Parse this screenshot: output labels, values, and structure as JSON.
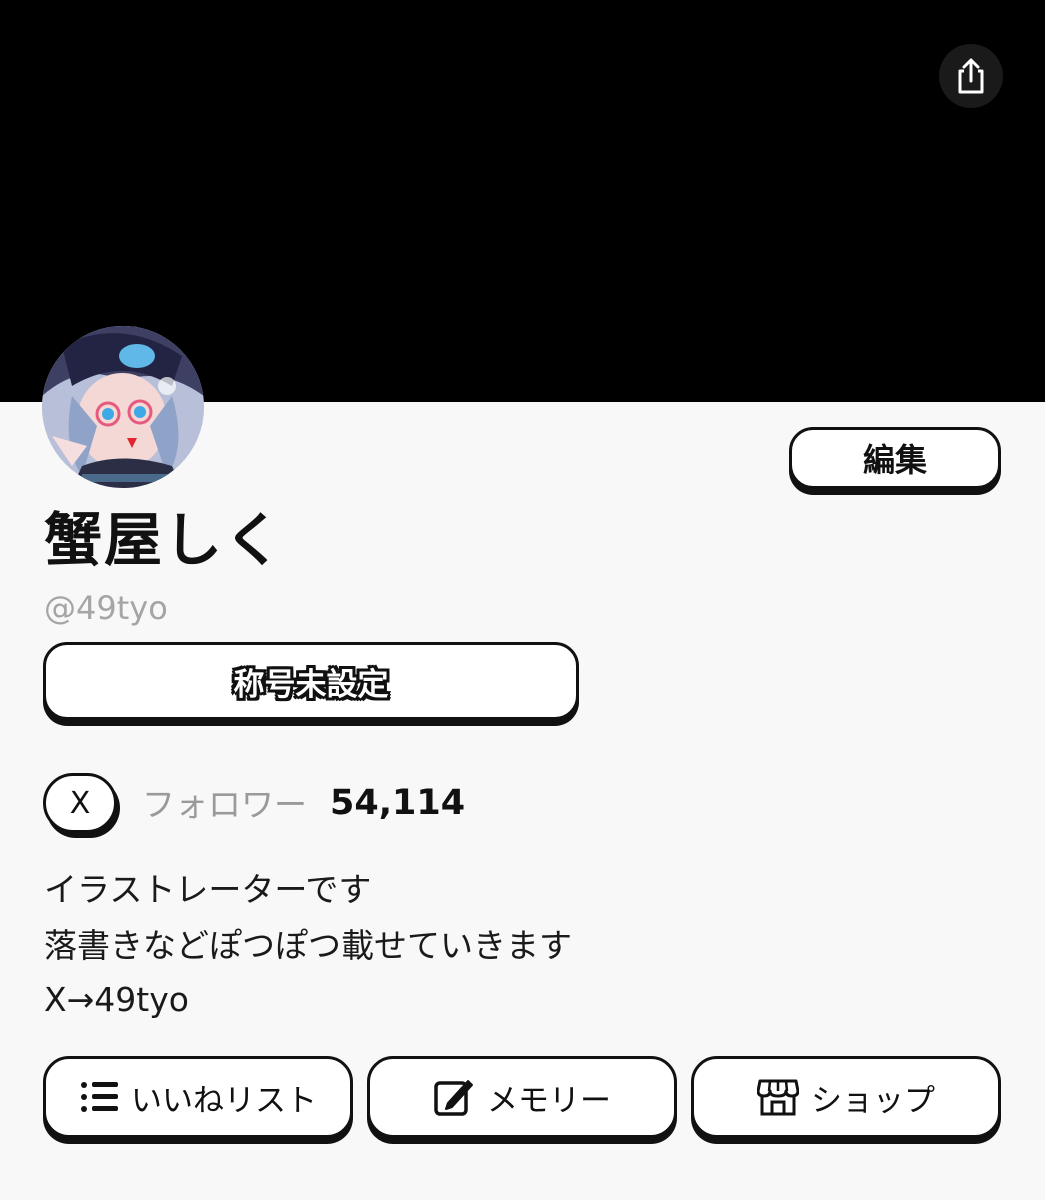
{
  "header": {
    "share_icon": "share-icon"
  },
  "profile": {
    "display_name": "蟹屋しく",
    "handle": "@49tyo",
    "edit_label": "編集",
    "title_badge": "称号未設定",
    "x_label": "X",
    "followers_label": "フォロワー",
    "followers_count": "54,114",
    "bio": [
      "イラストレーターです",
      "落書きなどぽつぽつ載せていきます",
      "X→49tyo"
    ]
  },
  "actions": [
    {
      "label": "いいねリスト",
      "icon": "list-icon"
    },
    {
      "label": "メモリー",
      "icon": "edit-note-icon"
    },
    {
      "label": "ショップ",
      "icon": "shop-icon"
    }
  ]
}
